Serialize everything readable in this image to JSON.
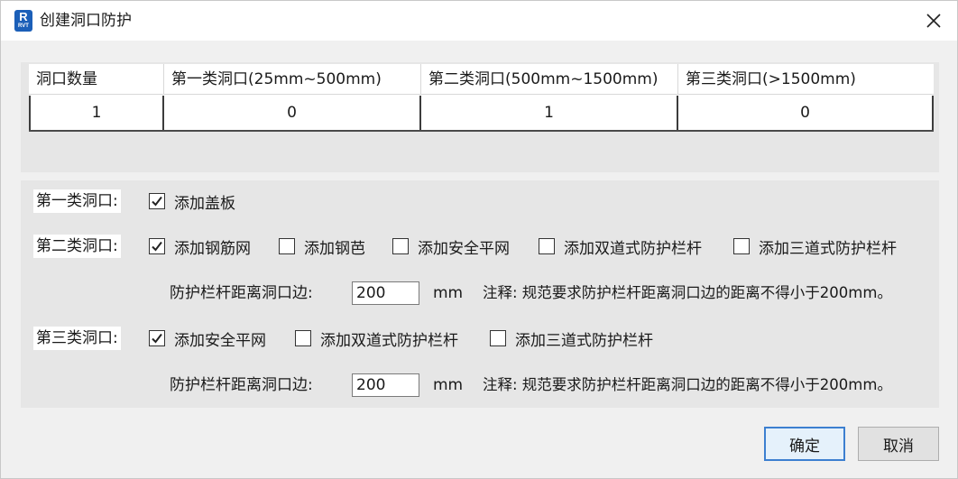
{
  "window": {
    "title": "创建洞口防护",
    "app_icon_text": "R",
    "app_icon_subtext": "RVT"
  },
  "grid": {
    "headers": [
      "洞口数量",
      "第一类洞口(25mm~500mm)",
      "第二类洞口(500mm~1500mm)",
      "第三类洞口(>1500mm)"
    ],
    "row": [
      "1",
      "0",
      "1",
      "0"
    ]
  },
  "class1": {
    "label": "第一类洞口:",
    "options": [
      {
        "label": "添加盖板",
        "checked": true
      }
    ]
  },
  "class2": {
    "label": "第二类洞口:",
    "options": [
      {
        "label": "添加钢筋网",
        "checked": true
      },
      {
        "label": "添加钢芭",
        "checked": false
      },
      {
        "label": "添加安全平网",
        "checked": false
      },
      {
        "label": "添加双道式防护栏杆",
        "checked": false
      },
      {
        "label": "添加三道式防护栏杆",
        "checked": false
      }
    ],
    "distance_label": "防护栏杆距离洞口边:",
    "distance_value": "200",
    "unit": "mm",
    "note": "注释: 规范要求防护栏杆距离洞口边的距离不得小于200mm。"
  },
  "class3": {
    "label": "第三类洞口:",
    "options": [
      {
        "label": "添加安全平网",
        "checked": true
      },
      {
        "label": "添加双道式防护栏杆",
        "checked": false
      },
      {
        "label": "添加三道式防护栏杆",
        "checked": false
      }
    ],
    "distance_label": "防护栏杆距离洞口边:",
    "distance_value": "200",
    "unit": "mm",
    "note": "注释: 规范要求防护栏杆距离洞口边的距离不得小于200mm。"
  },
  "buttons": {
    "ok": "确定",
    "cancel": "取消"
  },
  "colors": {
    "accent": "#1b5fb8",
    "primary_button_border": "#3c7fd0",
    "panel_bg": "#e6e6e6"
  }
}
